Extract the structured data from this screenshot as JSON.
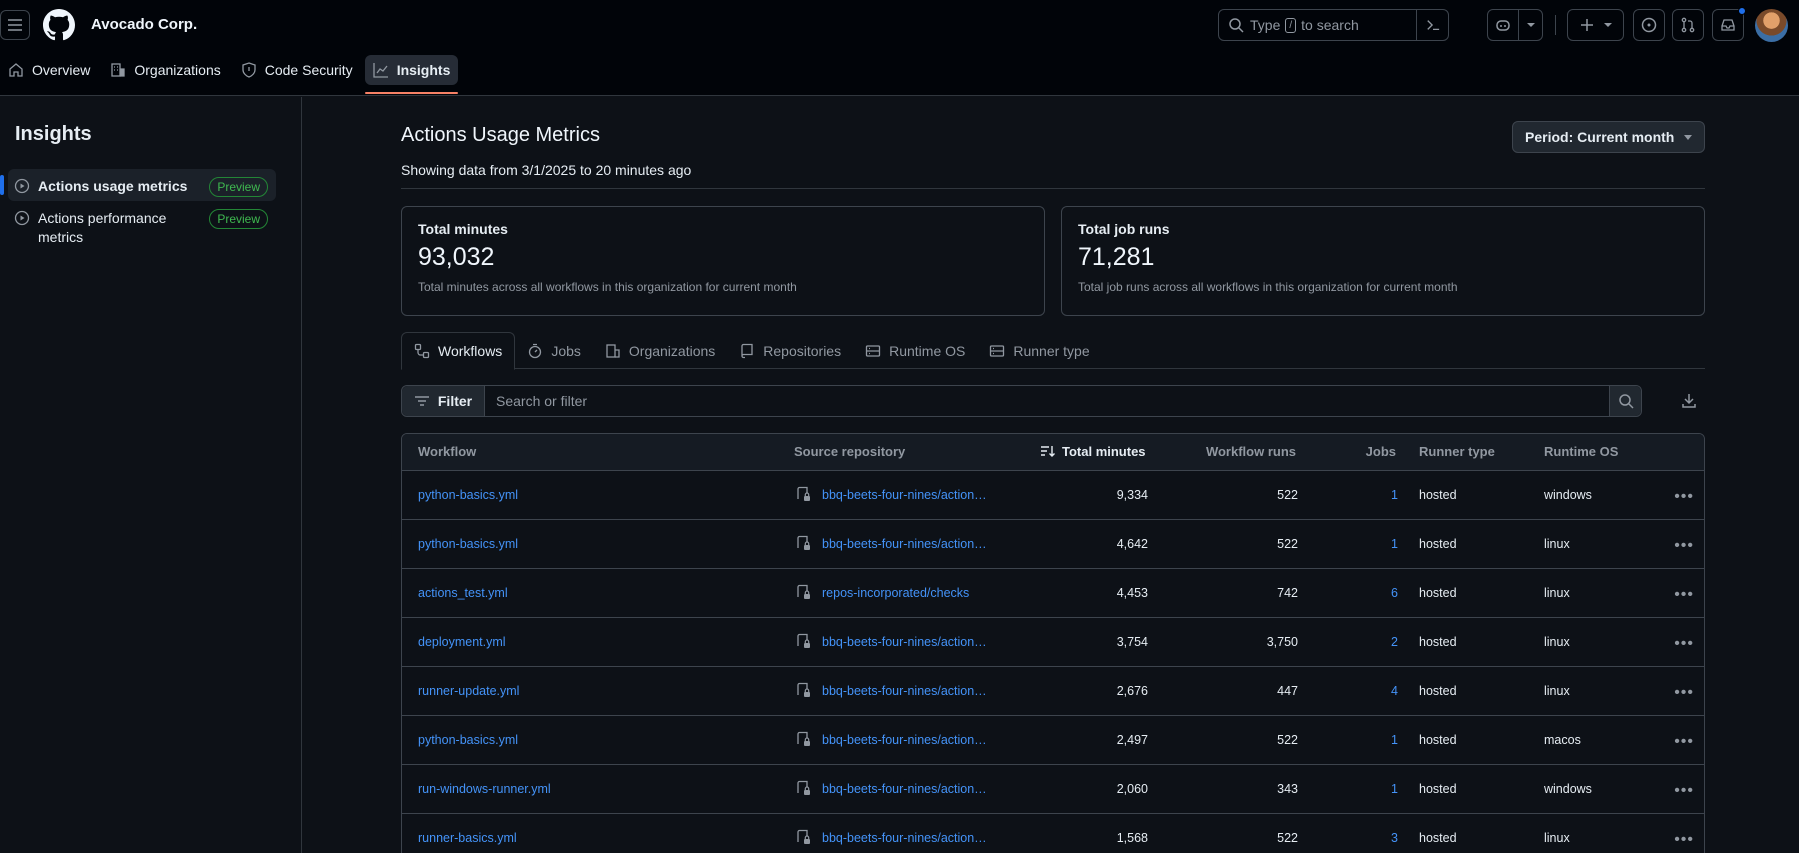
{
  "header": {
    "org_name": "Avocado Corp.",
    "search_prefix": "Type",
    "search_key": "/",
    "search_suffix": "to search"
  },
  "nav": {
    "items": [
      {
        "label": "Overview"
      },
      {
        "label": "Organizations"
      },
      {
        "label": "Code Security"
      },
      {
        "label": "Insights"
      }
    ]
  },
  "sidebar": {
    "title": "Insights",
    "items": [
      {
        "label": "Actions usage metrics",
        "badge": "Preview"
      },
      {
        "label": "Actions performance metrics",
        "badge": "Preview"
      }
    ]
  },
  "main": {
    "title": "Actions Usage Metrics",
    "subtitle": "Showing data from 3/1/2025 to 20 minutes ago",
    "period_label": "Period: Current month",
    "cards": [
      {
        "title": "Total minutes",
        "value": "93,032",
        "desc": "Total minutes across all workflows in this organization for current month"
      },
      {
        "title": "Total job runs",
        "value": "71,281",
        "desc": "Total job runs across all workflows in this organization for current month"
      }
    ],
    "tabs": [
      {
        "label": "Workflows"
      },
      {
        "label": "Jobs"
      },
      {
        "label": "Organizations"
      },
      {
        "label": "Repositories"
      },
      {
        "label": "Runtime OS"
      },
      {
        "label": "Runner type"
      }
    ],
    "filter_label": "Filter",
    "filter_placeholder": "Search or filter"
  },
  "table": {
    "headers": {
      "workflow": "Workflow",
      "source": "Source repository",
      "total_minutes": "Total minutes",
      "workflow_runs": "Workflow runs",
      "jobs": "Jobs",
      "runner_type": "Runner type",
      "runtime_os": "Runtime OS"
    },
    "rows": [
      {
        "workflow": "python-basics.yml",
        "repo": "bbq-beets-four-nines/action…",
        "minutes": "9,334",
        "runs": "522",
        "jobs": "1",
        "runner": "hosted",
        "os": "windows"
      },
      {
        "workflow": "python-basics.yml",
        "repo": "bbq-beets-four-nines/action…",
        "minutes": "4,642",
        "runs": "522",
        "jobs": "1",
        "runner": "hosted",
        "os": "linux"
      },
      {
        "workflow": "actions_test.yml",
        "repo": "repos-incorporated/checks",
        "minutes": "4,453",
        "runs": "742",
        "jobs": "6",
        "runner": "hosted",
        "os": "linux"
      },
      {
        "workflow": "deployment.yml",
        "repo": "bbq-beets-four-nines/action…",
        "minutes": "3,754",
        "runs": "3,750",
        "jobs": "2",
        "runner": "hosted",
        "os": "linux"
      },
      {
        "workflow": "runner-update.yml",
        "repo": "bbq-beets-four-nines/action…",
        "minutes": "2,676",
        "runs": "447",
        "jobs": "4",
        "runner": "hosted",
        "os": "linux"
      },
      {
        "workflow": "python-basics.yml",
        "repo": "bbq-beets-four-nines/action…",
        "minutes": "2,497",
        "runs": "522",
        "jobs": "1",
        "runner": "hosted",
        "os": "macos"
      },
      {
        "workflow": "run-windows-runner.yml",
        "repo": "bbq-beets-four-nines/action…",
        "minutes": "2,060",
        "runs": "343",
        "jobs": "1",
        "runner": "hosted",
        "os": "windows"
      },
      {
        "workflow": "runner-basics.yml",
        "repo": "bbq-beets-four-nines/action…",
        "minutes": "1,568",
        "runs": "522",
        "jobs": "3",
        "runner": "hosted",
        "os": "linux"
      }
    ]
  },
  "colors": {
    "accent": "#4493f8",
    "underline": "#f78166",
    "badge": "#3fb950"
  }
}
